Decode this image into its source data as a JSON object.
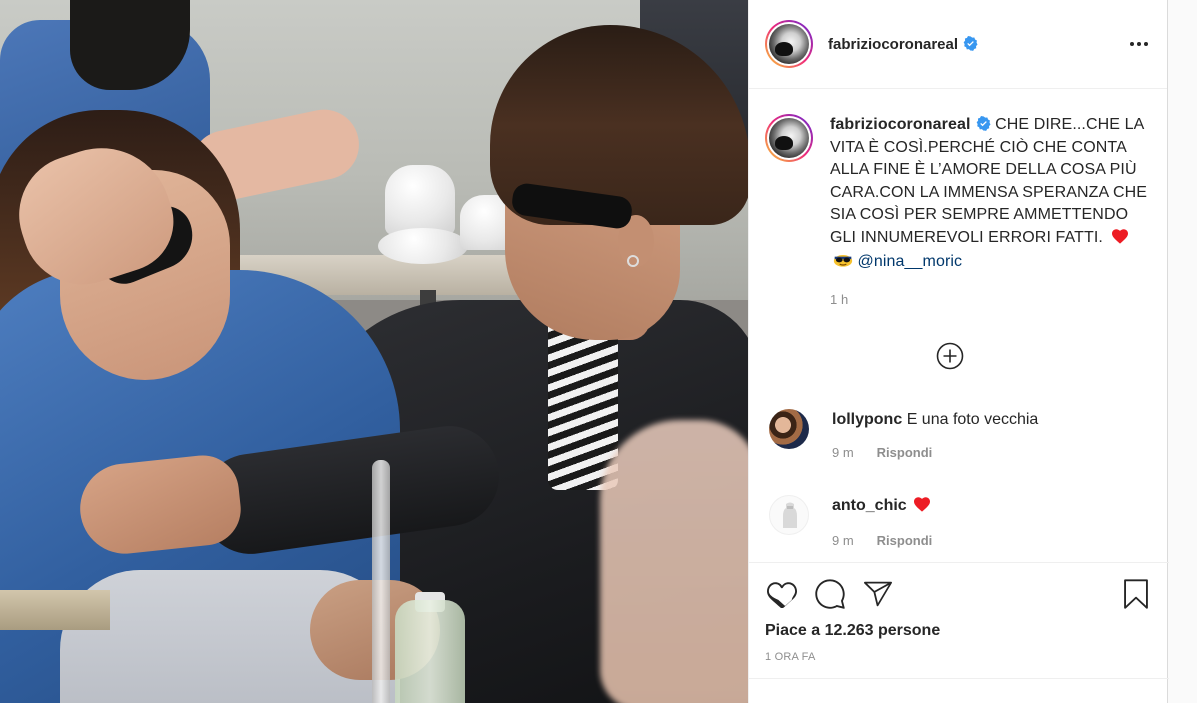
{
  "post": {
    "author": "fabriziocoronareal",
    "verified": true,
    "caption": "CHE DIRE...CHE LA VITA È COSÌ.PERCHÉ CIÒ CHE CONTA ALLA FINE È L’AMORE DELLA COSA PIÙ CARA.CON LA IMMENSA SPERANZA CHE SIA COSÌ PER SEMPRE AMMETTENDO GLI INNUMEREVOLI ERRORI FATTI.",
    "caption_emojis": [
      "heart-emoji",
      "sunglasses-emoji"
    ],
    "mention": "@nina__moric",
    "caption_time": "1 h",
    "likes": "Piace a 12.263 persone",
    "posted_ago": "1 ORA FA"
  },
  "comments": [
    {
      "user": "lollyponc",
      "text": "E una foto vecchia",
      "time": "9 m",
      "reply": "Rispondi"
    },
    {
      "user": "anto_chic",
      "text": "",
      "emoji": "heart-emoji",
      "time": "9 m",
      "reply": "Rispondi"
    }
  ],
  "colors": {
    "text": "#262626",
    "muted": "#8e8e8e",
    "mention": "#00376b",
    "verified": "#3897f0",
    "heart": "#ed4956",
    "border": "#efefef"
  }
}
